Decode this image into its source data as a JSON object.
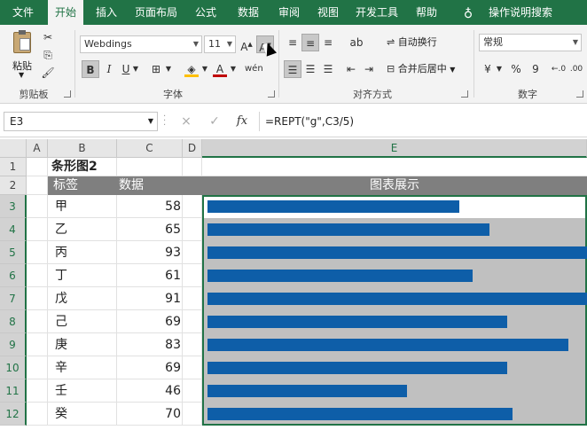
{
  "menu": {
    "items": [
      "文件",
      "开始",
      "插入",
      "页面布局",
      "公式",
      "数据",
      "审阅",
      "视图",
      "开发工具",
      "帮助"
    ],
    "active": "开始",
    "search_icon": "lightbulb-icon",
    "search_label": "操作说明搜索"
  },
  "ribbon": {
    "clipboard": {
      "paste": "粘贴",
      "label": "剪贴板"
    },
    "font": {
      "name": "Webdings",
      "size": "11",
      "label": "字体"
    },
    "alignment": {
      "wrap": "自动换行",
      "merge": "合并后居中",
      "label": "对齐方式"
    },
    "number": {
      "format": "常规",
      "label": "数字",
      "percent": "%",
      "comma": "9"
    }
  },
  "formula_bar": {
    "name_box": "E3",
    "formula": "=REPT(\"g\",C3/5)",
    "cancel": "×",
    "enter": "✓",
    "fx": "fx"
  },
  "sheet": {
    "columns": [
      "A",
      "B",
      "C",
      "D",
      "E"
    ],
    "selected_column": "E",
    "rows": [
      "1",
      "2",
      "3",
      "4",
      "5",
      "6",
      "7",
      "8",
      "9",
      "10",
      "11",
      "12"
    ],
    "title": "条形图2",
    "header": {
      "label": "标签",
      "value": "数据",
      "chart": "图表展示"
    },
    "bar_color": "#0e5ea8",
    "header_bg": "#7f7f7f",
    "chart_area_bg": "#c0c0c0"
  },
  "chart_data": {
    "type": "bar",
    "categories": [
      "甲",
      "乙",
      "丙",
      "丁",
      "戊",
      "己",
      "庚",
      "辛",
      "壬",
      "癸"
    ],
    "values": [
      58,
      65,
      93,
      61,
      91,
      69,
      83,
      69,
      46,
      70
    ],
    "title": "条形图2",
    "xlabel": "标签",
    "ylabel": "数据"
  }
}
